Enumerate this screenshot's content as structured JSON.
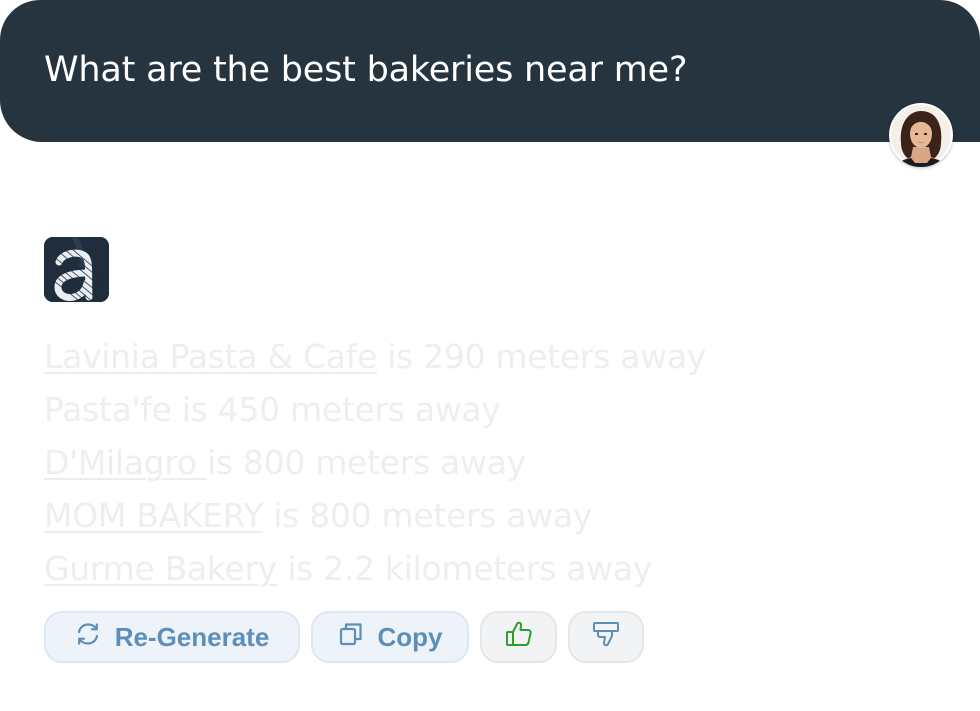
{
  "prompt": {
    "text": "What are the best bakeries near me?"
  },
  "response": {
    "lines": [
      {
        "place": "Lavinia Pasta & Cafe",
        "place_linked": true,
        "distance": " is 290 meters away"
      },
      {
        "place": "Pasta'fe",
        "place_linked": false,
        "distance": " is 450 meters away"
      },
      {
        "place": "D'Milagro ",
        "place_linked": true,
        "distance": " is 800 meters away"
      },
      {
        "place": "MOM BAKERY",
        "place_linked": true,
        "distance": " is 800 meters away"
      },
      {
        "place": "Gurme Bakery",
        "place_linked": true,
        "distance": " is 2.2 kilometers away"
      }
    ]
  },
  "actions": {
    "regenerate_label": "Re-Generate",
    "copy_label": "Copy",
    "regenerate_icon": "refresh-icon",
    "copy_icon": "copy-icon",
    "like_icon": "thumbs-up-icon",
    "dislike_icon": "thumbs-down-icon"
  },
  "colors": {
    "prompt_background": "#263440",
    "accent_blue": "#5e8fb9",
    "like_green": "#2e9e2e",
    "dislike_blue": "#5e8fb9"
  }
}
